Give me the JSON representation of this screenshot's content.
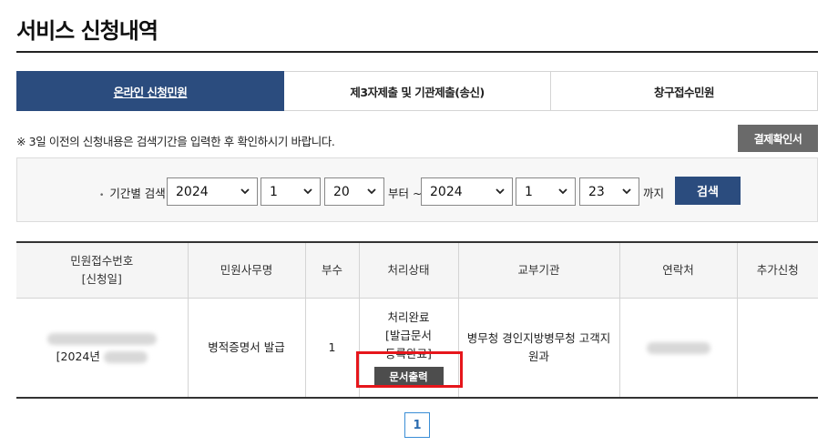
{
  "page": {
    "title": "서비스 신청내역"
  },
  "tabs": [
    {
      "label": "온라인 신청민원",
      "active": true
    },
    {
      "label": "제3자제출 및 기관제출(송신)",
      "active": false
    },
    {
      "label": "창구접수민원",
      "active": false
    }
  ],
  "notice": "※ 3일 이전의 신청내용은 검색기간을 입력한 후 확인하시기 바랍니다.",
  "buttons": {
    "payment_confirm": "결제확인서",
    "search": "검색",
    "print": "문서출력"
  },
  "search": {
    "label": "기간별 검색",
    "from": {
      "year": "2024",
      "month": "1",
      "day": "20"
    },
    "to": {
      "year": "2024",
      "month": "1",
      "day": "23"
    },
    "from_suffix": "부터 ~",
    "to_suffix": "까지"
  },
  "table": {
    "headers": {
      "receipt": [
        "민원접수번호",
        "[신청일]"
      ],
      "name": "민원사무명",
      "copies": "부수",
      "status": "처리상태",
      "agency": "교부기관",
      "contact": "연락처",
      "extra": "추가신청"
    },
    "rows": [
      {
        "receipt_date_prefix": "[2024년",
        "name": "병적증명서 발급",
        "copies": "1",
        "status_lines": [
          "처리완료",
          "[발급문서",
          "등록완료]"
        ],
        "agency": "병무청 경인지방병무청 고객지원과"
      }
    ]
  },
  "pagination": {
    "current": "1"
  },
  "colors": {
    "primary": "#2b4c7e",
    "highlight": "#e6161b",
    "gray_button": "#6a6a6a"
  }
}
